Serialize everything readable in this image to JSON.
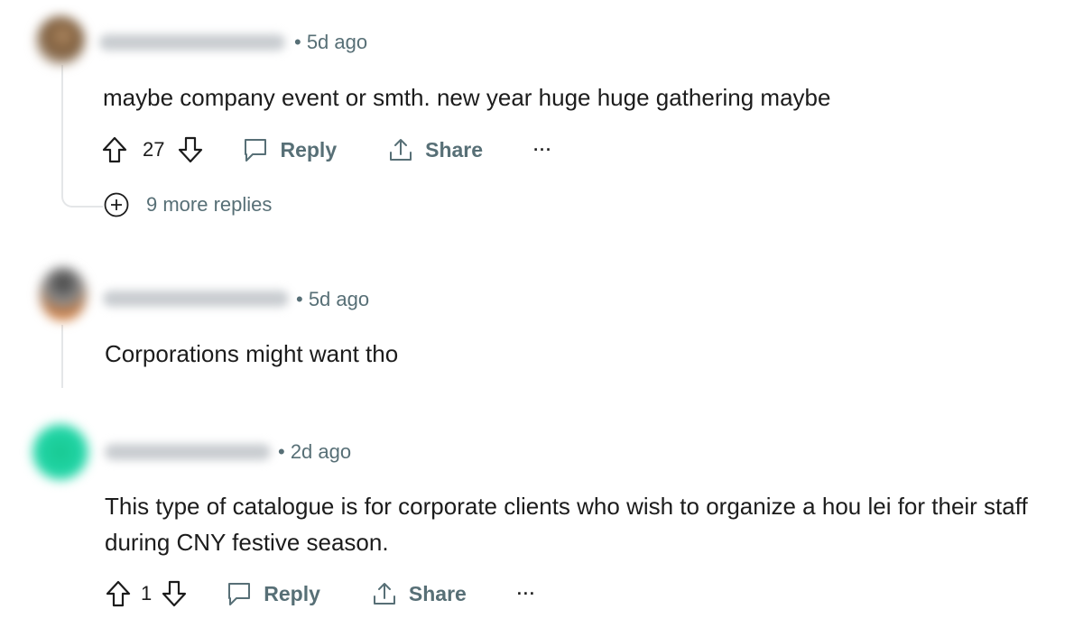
{
  "comments": [
    {
      "author_time": "• 5d ago",
      "body": "maybe company event or smth. new year huge huge gathering maybe",
      "score": "27",
      "reply_label": "Reply",
      "share_label": "Share",
      "more_label": "···",
      "more_replies_label": "9 more replies",
      "avatar_color": "#8a6a4a"
    },
    {
      "author_time": "• 5d ago",
      "body": "Corporations might want tho",
      "avatar_color": "#5a5a5a"
    },
    {
      "author_time": "• 2d ago",
      "body": "This type of catalogue is for corporate clients who wish to organize a hou lei for their staff during CNY festive season.",
      "score": "1",
      "reply_label": "Reply",
      "share_label": "Share",
      "more_label": "···",
      "avatar_color": "#1fcf9c"
    }
  ],
  "colors": {
    "meta": "#576f76",
    "thread": "#e4e6e8",
    "text": "#1c1c1c"
  },
  "icons": [
    "upvote-icon",
    "downvote-icon",
    "comment-bubble-icon",
    "share-icon",
    "plus-circle-icon",
    "overflow-menu-icon"
  ]
}
